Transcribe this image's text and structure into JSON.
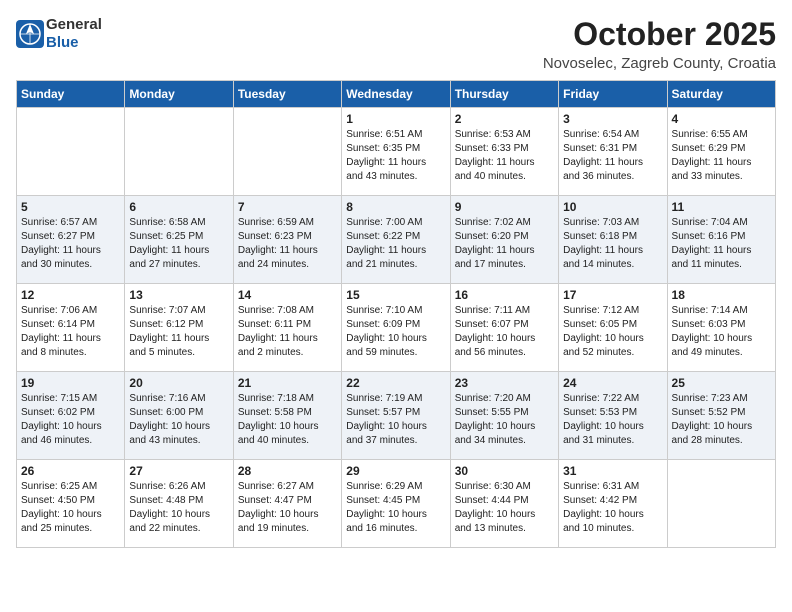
{
  "header": {
    "logo_general": "General",
    "logo_blue": "Blue",
    "month_title": "October 2025",
    "location": "Novoselec, Zagreb County, Croatia"
  },
  "days_of_week": [
    "Sunday",
    "Monday",
    "Tuesday",
    "Wednesday",
    "Thursday",
    "Friday",
    "Saturday"
  ],
  "weeks": [
    [
      {
        "day": "",
        "info": ""
      },
      {
        "day": "",
        "info": ""
      },
      {
        "day": "",
        "info": ""
      },
      {
        "day": "1",
        "info": "Sunrise: 6:51 AM\nSunset: 6:35 PM\nDaylight: 11 hours\nand 43 minutes."
      },
      {
        "day": "2",
        "info": "Sunrise: 6:53 AM\nSunset: 6:33 PM\nDaylight: 11 hours\nand 40 minutes."
      },
      {
        "day": "3",
        "info": "Sunrise: 6:54 AM\nSunset: 6:31 PM\nDaylight: 11 hours\nand 36 minutes."
      },
      {
        "day": "4",
        "info": "Sunrise: 6:55 AM\nSunset: 6:29 PM\nDaylight: 11 hours\nand 33 minutes."
      }
    ],
    [
      {
        "day": "5",
        "info": "Sunrise: 6:57 AM\nSunset: 6:27 PM\nDaylight: 11 hours\nand 30 minutes."
      },
      {
        "day": "6",
        "info": "Sunrise: 6:58 AM\nSunset: 6:25 PM\nDaylight: 11 hours\nand 27 minutes."
      },
      {
        "day": "7",
        "info": "Sunrise: 6:59 AM\nSunset: 6:23 PM\nDaylight: 11 hours\nand 24 minutes."
      },
      {
        "day": "8",
        "info": "Sunrise: 7:00 AM\nSunset: 6:22 PM\nDaylight: 11 hours\nand 21 minutes."
      },
      {
        "day": "9",
        "info": "Sunrise: 7:02 AM\nSunset: 6:20 PM\nDaylight: 11 hours\nand 17 minutes."
      },
      {
        "day": "10",
        "info": "Sunrise: 7:03 AM\nSunset: 6:18 PM\nDaylight: 11 hours\nand 14 minutes."
      },
      {
        "day": "11",
        "info": "Sunrise: 7:04 AM\nSunset: 6:16 PM\nDaylight: 11 hours\nand 11 minutes."
      }
    ],
    [
      {
        "day": "12",
        "info": "Sunrise: 7:06 AM\nSunset: 6:14 PM\nDaylight: 11 hours\nand 8 minutes."
      },
      {
        "day": "13",
        "info": "Sunrise: 7:07 AM\nSunset: 6:12 PM\nDaylight: 11 hours\nand 5 minutes."
      },
      {
        "day": "14",
        "info": "Sunrise: 7:08 AM\nSunset: 6:11 PM\nDaylight: 11 hours\nand 2 minutes."
      },
      {
        "day": "15",
        "info": "Sunrise: 7:10 AM\nSunset: 6:09 PM\nDaylight: 10 hours\nand 59 minutes."
      },
      {
        "day": "16",
        "info": "Sunrise: 7:11 AM\nSunset: 6:07 PM\nDaylight: 10 hours\nand 56 minutes."
      },
      {
        "day": "17",
        "info": "Sunrise: 7:12 AM\nSunset: 6:05 PM\nDaylight: 10 hours\nand 52 minutes."
      },
      {
        "day": "18",
        "info": "Sunrise: 7:14 AM\nSunset: 6:03 PM\nDaylight: 10 hours\nand 49 minutes."
      }
    ],
    [
      {
        "day": "19",
        "info": "Sunrise: 7:15 AM\nSunset: 6:02 PM\nDaylight: 10 hours\nand 46 minutes."
      },
      {
        "day": "20",
        "info": "Sunrise: 7:16 AM\nSunset: 6:00 PM\nDaylight: 10 hours\nand 43 minutes."
      },
      {
        "day": "21",
        "info": "Sunrise: 7:18 AM\nSunset: 5:58 PM\nDaylight: 10 hours\nand 40 minutes."
      },
      {
        "day": "22",
        "info": "Sunrise: 7:19 AM\nSunset: 5:57 PM\nDaylight: 10 hours\nand 37 minutes."
      },
      {
        "day": "23",
        "info": "Sunrise: 7:20 AM\nSunset: 5:55 PM\nDaylight: 10 hours\nand 34 minutes."
      },
      {
        "day": "24",
        "info": "Sunrise: 7:22 AM\nSunset: 5:53 PM\nDaylight: 10 hours\nand 31 minutes."
      },
      {
        "day": "25",
        "info": "Sunrise: 7:23 AM\nSunset: 5:52 PM\nDaylight: 10 hours\nand 28 minutes."
      }
    ],
    [
      {
        "day": "26",
        "info": "Sunrise: 6:25 AM\nSunset: 4:50 PM\nDaylight: 10 hours\nand 25 minutes."
      },
      {
        "day": "27",
        "info": "Sunrise: 6:26 AM\nSunset: 4:48 PM\nDaylight: 10 hours\nand 22 minutes."
      },
      {
        "day": "28",
        "info": "Sunrise: 6:27 AM\nSunset: 4:47 PM\nDaylight: 10 hours\nand 19 minutes."
      },
      {
        "day": "29",
        "info": "Sunrise: 6:29 AM\nSunset: 4:45 PM\nDaylight: 10 hours\nand 16 minutes."
      },
      {
        "day": "30",
        "info": "Sunrise: 6:30 AM\nSunset: 4:44 PM\nDaylight: 10 hours\nand 13 minutes."
      },
      {
        "day": "31",
        "info": "Sunrise: 6:31 AM\nSunset: 4:42 PM\nDaylight: 10 hours\nand 10 minutes."
      },
      {
        "day": "",
        "info": ""
      }
    ]
  ]
}
